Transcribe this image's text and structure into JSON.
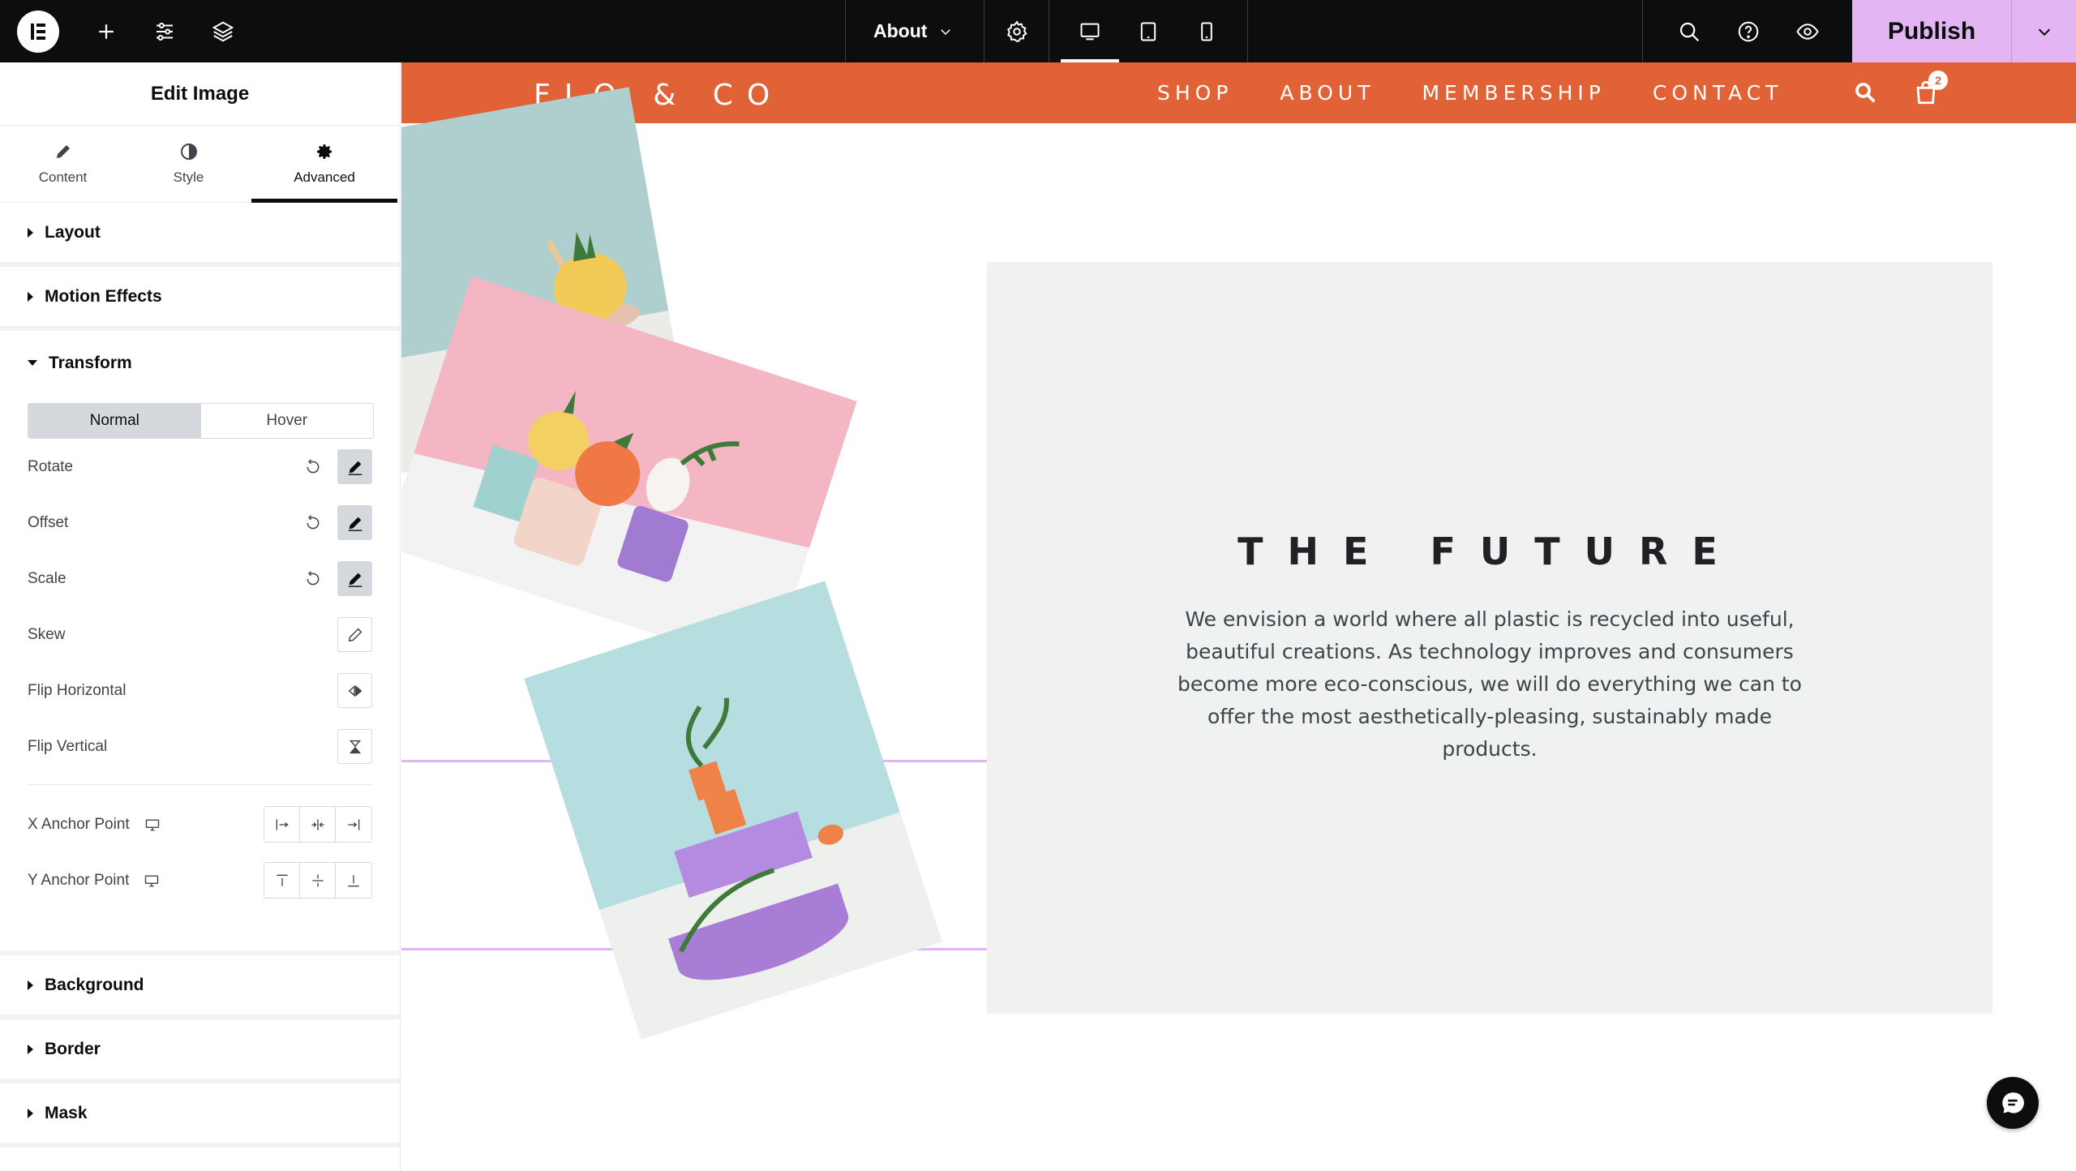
{
  "app": {
    "page_selector": "About",
    "publish_label": "Publish"
  },
  "panel": {
    "title": "Edit Image",
    "tabs": [
      {
        "label": "Content",
        "icon": "pencil-icon"
      },
      {
        "label": "Style",
        "icon": "contrast-icon"
      },
      {
        "label": "Advanced",
        "icon": "gear-icon"
      }
    ],
    "active_tab": "Advanced",
    "sections": {
      "layout": "Layout",
      "motion": "Motion Effects",
      "transform": "Transform",
      "background": "Background",
      "border": "Border",
      "mask": "Mask"
    },
    "transform": {
      "states": [
        "Normal",
        "Hover"
      ],
      "active_state": "Normal",
      "controls": {
        "rotate": "Rotate",
        "offset": "Offset",
        "scale": "Scale",
        "skew": "Skew",
        "flip_h": "Flip Horizontal",
        "flip_v": "Flip Vertical"
      },
      "x_anchor": "X Anchor Point",
      "y_anchor": "Y Anchor Point"
    }
  },
  "site": {
    "logo": "FLO & CO",
    "nav": [
      "SHOP",
      "ABOUT",
      "MEMBERSHIP",
      "CONTACT"
    ],
    "cart_count": "2",
    "future_title": "THE FUTURE",
    "future_text": "We envision a world where all plastic is recycled into useful, beautiful creations. As technology improves and consumers become more eco-conscious, we will do everything we can to offer the most aesthetically-pleasing, sustainably made products."
  },
  "colors": {
    "header_accent": "#e06236",
    "publish_bg": "#e3b5f2",
    "topbar_bg": "#0c0d0e",
    "future_box_bg": "#eff2f0"
  }
}
